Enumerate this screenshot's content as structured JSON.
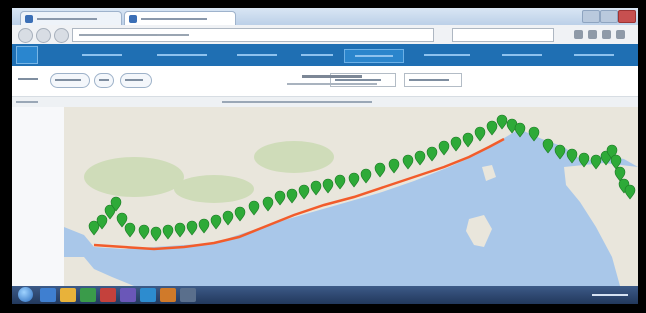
{
  "browser": {
    "tabs": [
      {
        "label": "",
        "active": false
      },
      {
        "label": "",
        "active": true
      }
    ],
    "address": "",
    "search_placeholder": ""
  },
  "app_nav": {
    "items": [
      {
        "label": ""
      },
      {
        "label": ""
      },
      {
        "label": ""
      },
      {
        "label": ""
      },
      {
        "label": "",
        "active": true
      },
      {
        "label": ""
      },
      {
        "label": ""
      },
      {
        "label": ""
      }
    ]
  },
  "controls": {
    "view_label": "",
    "buttons": [
      {
        "label": ""
      },
      {
        "label": ""
      },
      {
        "label": ""
      }
    ],
    "selects": [
      {
        "value": ""
      },
      {
        "value": ""
      }
    ],
    "map_title": "",
    "map_subtitle": ""
  },
  "infobar": {
    "left_text": "",
    "center_text": ""
  },
  "map": {
    "route_color": "#f25c2b",
    "marker_color": "#2eaa38",
    "water_color": "#a9c7e9",
    "land_color": "#e9e6dc",
    "relief_color": "#cfdcb9"
  },
  "taskbar": {
    "clock": ""
  }
}
